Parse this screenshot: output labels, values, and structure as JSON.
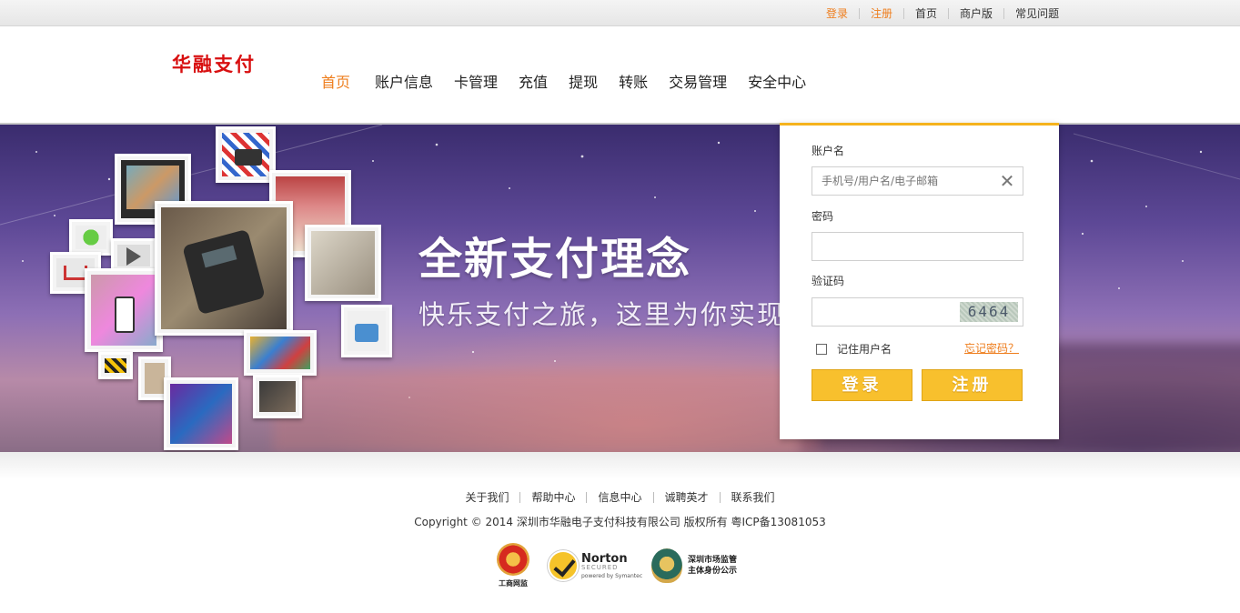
{
  "topbar": {
    "links": [
      "登录",
      "注册",
      "首页",
      "商户版",
      "常见问题"
    ]
  },
  "header": {
    "logo": "华融支付",
    "nav": [
      "首页",
      "账户信息",
      "卡管理",
      "充值",
      "提现",
      "转账",
      "交易管理",
      "安全中心"
    ],
    "active_nav": "首页"
  },
  "banner": {
    "title": "全新支付理念",
    "subtitle": "快乐支付之旅，这里为你实现"
  },
  "login": {
    "account_label": "账户名",
    "account_placeholder": "手机号/用户名/电子邮箱",
    "password_label": "密码",
    "captcha_label": "验证码",
    "captcha_code": "6464",
    "remember_label": "记住用户名",
    "forgot_link": "忘记密码？",
    "login_button": "登录",
    "register_button": "注册"
  },
  "footer": {
    "links": [
      "关于我们",
      "帮助中心",
      "信息中心",
      "诚聘英才",
      "联系我们"
    ],
    "copyright": "Copyright © 2014 深圳市华融电子支付科技有限公司 版权所有 粤ICP备13081053",
    "badges": {
      "gongshang": "工商网监",
      "norton": "Norton",
      "norton_secured": "SECURED",
      "norton_powered": "powered by Symantec",
      "sz_line1": "深圳市场监管",
      "sz_line2": "主体身份公示"
    }
  },
  "colors": {
    "accent_orange": "#ee7d1c",
    "button_yellow": "#f8c02d",
    "logo_red": "#d80f10"
  }
}
